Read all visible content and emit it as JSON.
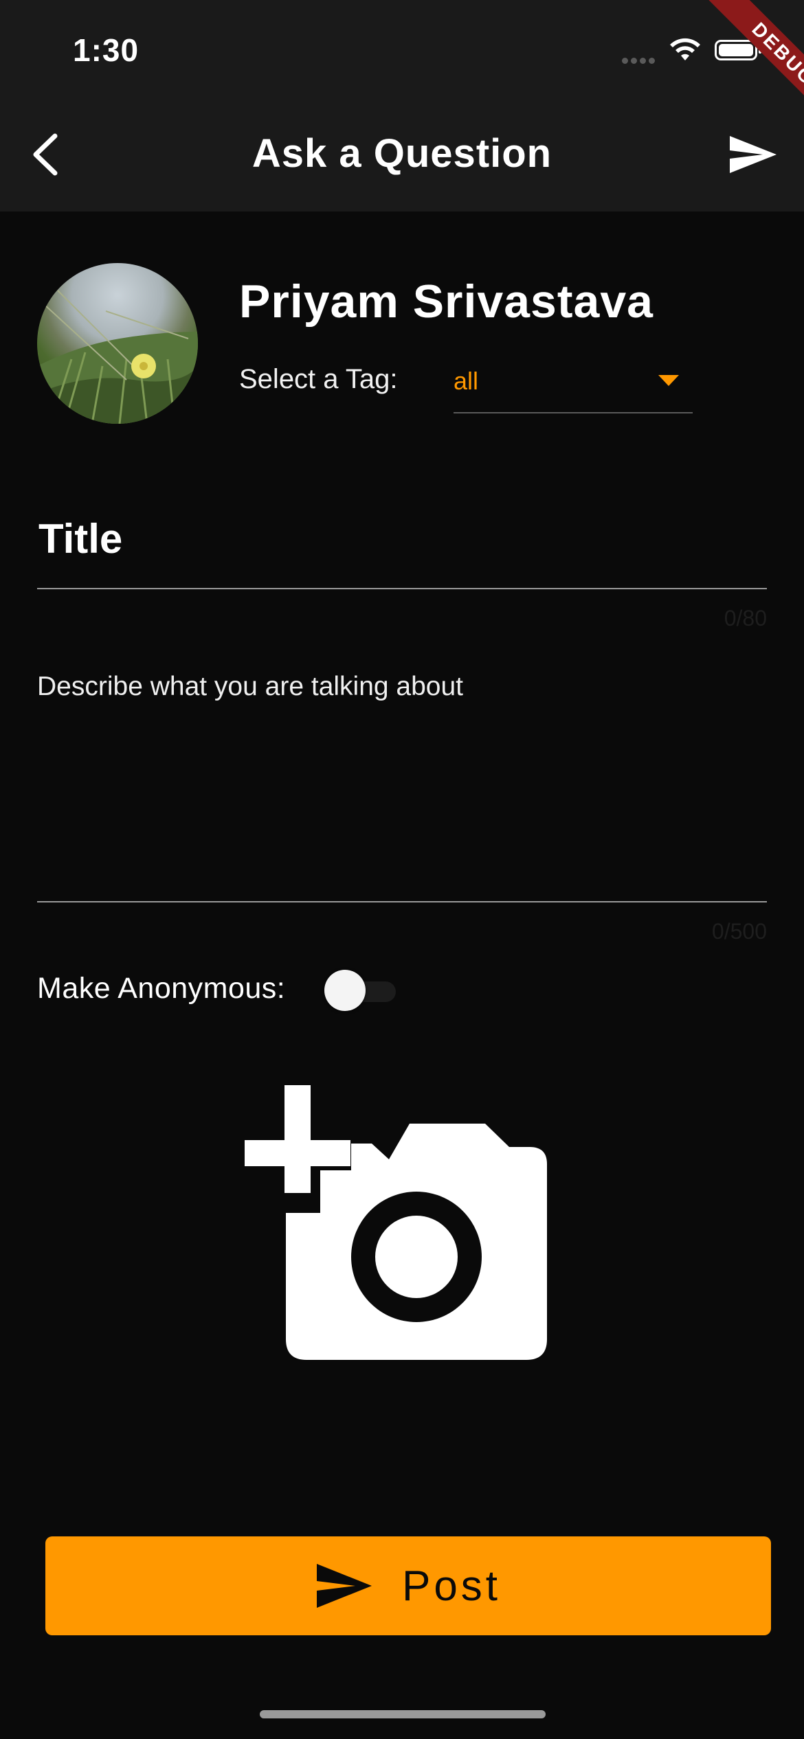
{
  "status_bar": {
    "time": "1:30",
    "debug_banner": "DEBUG"
  },
  "app_bar": {
    "title": "Ask a Question",
    "back_icon": "chevron-left-icon",
    "action_icon": "send-icon"
  },
  "profile": {
    "user_name": "Priyam Srivastava",
    "tag_label": "Select a Tag:",
    "tag_value": "all"
  },
  "form": {
    "title_placeholder": "Title",
    "title_counter": "0/80",
    "description_placeholder": "Describe what you are talking about",
    "description_counter": "0/500",
    "anonymous_label": "Make Anonymous:",
    "anonymous_on": false,
    "add_photo_icon": "add-a-photo-icon"
  },
  "post_button": {
    "label": "Post",
    "icon": "send-icon"
  },
  "colors": {
    "accent": "#ff9800",
    "background": "#0a0a0a",
    "app_bar": "#1a1a1a",
    "debug_banner": "#8c1a1a"
  }
}
